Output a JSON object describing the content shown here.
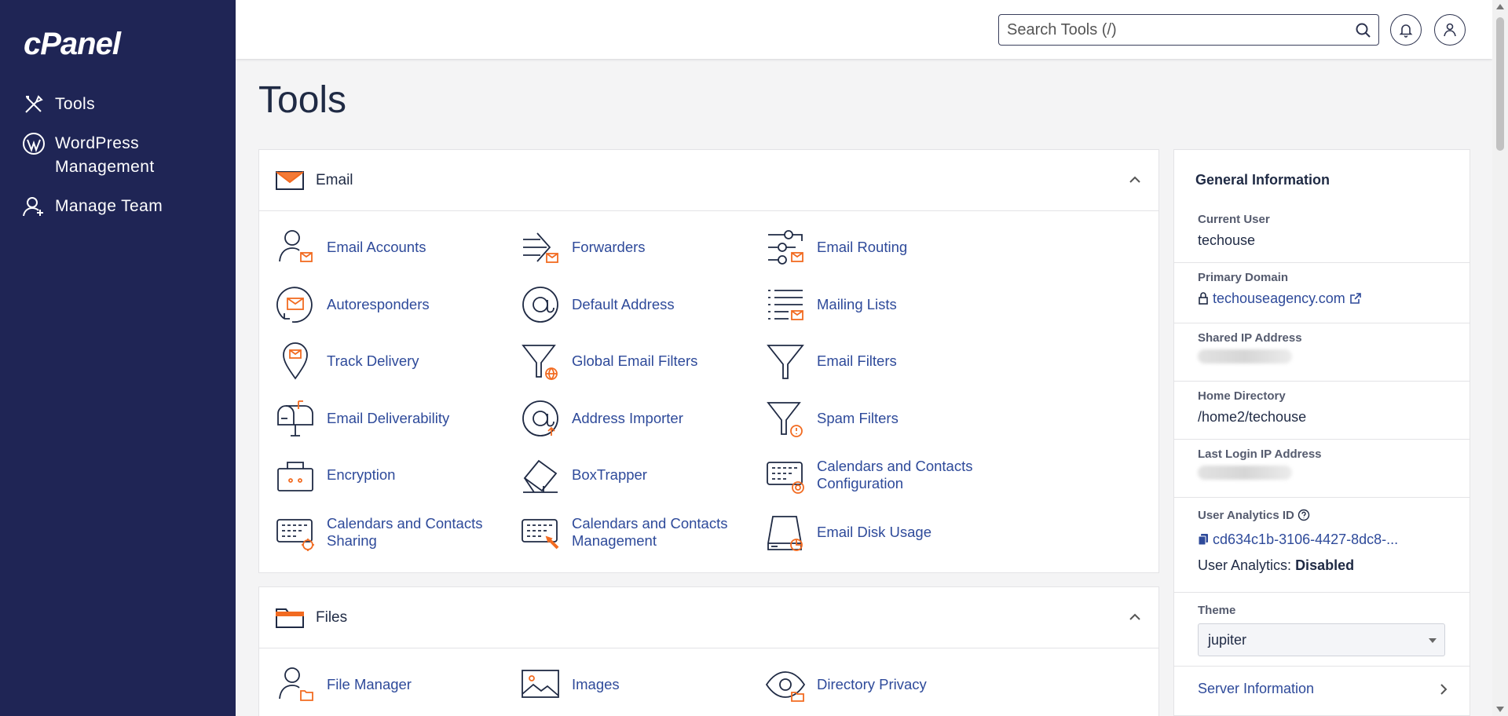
{
  "brand": {
    "logo_text": "cPanel",
    "sidebar_bg": "#1f2555",
    "accent": "#f26b21",
    "link": "#2e4a9a"
  },
  "sidebar": {
    "items": [
      {
        "label": "Tools",
        "icon": "tools-icon"
      },
      {
        "label": "WordPress Management",
        "icon": "wordpress-icon"
      },
      {
        "label": "Manage Team",
        "icon": "manage-team-icon"
      }
    ]
  },
  "topbar": {
    "search_placeholder": "Search Tools (/)",
    "search_icon": "search-icon",
    "notifications_icon": "bell-icon",
    "user_icon": "user-icon"
  },
  "page": {
    "title": "Tools"
  },
  "sections": {
    "email": {
      "title": "Email",
      "tools": [
        "Email Accounts",
        "Forwarders",
        "Email Routing",
        "Autoresponders",
        "Default Address",
        "Mailing Lists",
        "Track Delivery",
        "Global Email Filters",
        "Email Filters",
        "Email Deliverability",
        "Address Importer",
        "Spam Filters",
        "Encryption",
        "BoxTrapper",
        "Calendars and Contacts Configuration",
        "Calendars and Contacts Sharing",
        "Calendars and Contacts Management",
        "Email Disk Usage"
      ]
    },
    "files": {
      "title": "Files",
      "tools": [
        "File Manager",
        "Images",
        "Directory Privacy"
      ]
    }
  },
  "general_info": {
    "title": "General Information",
    "current_user_label": "Current User",
    "current_user": "techouse",
    "primary_domain_label": "Primary Domain",
    "primary_domain": "techouseagency.com",
    "shared_ip_label": "Shared IP Address",
    "home_dir_label": "Home Directory",
    "home_dir": "/home2/techouse",
    "last_login_label": "Last Login IP Address",
    "analytics_id_label": "User Analytics ID",
    "analytics_id": "cd634c1b-3106-4427-8dc8-...",
    "analytics_status_label": "User Analytics:",
    "analytics_status": "Disabled",
    "theme_label": "Theme",
    "theme_value": "jupiter",
    "server_info": "Server Information"
  }
}
